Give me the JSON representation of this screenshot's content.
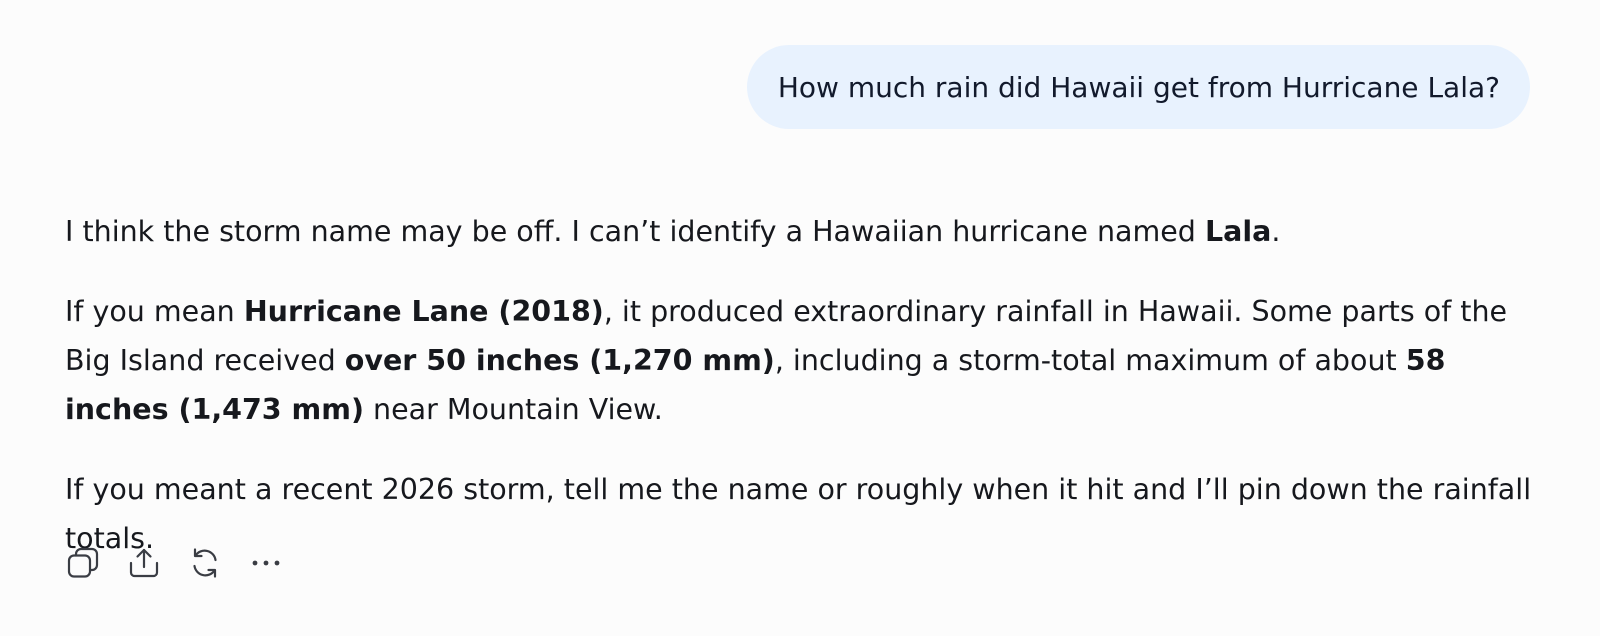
{
  "user_message": {
    "text": "How much rain did Hawaii get from Hurricane Lala?"
  },
  "assistant_message": {
    "p1": {
      "t1": "I think the storm name may be off. I can’t identify a Hawaiian hurricane named ",
      "b1": "Lala",
      "t2": "."
    },
    "p2": {
      "t1": "If you mean ",
      "b1": "Hurricane Lane (2018)",
      "t2": ", it produced extraordinary rainfall in Hawaii. Some parts of the Big Island received ",
      "b2": "over 50 inches (1,270 mm)",
      "t3": ", including a storm-total maximum of about ",
      "b3": "58 inches (1,473 mm)",
      "t4": " near Mountain View."
    },
    "p3": {
      "t1": "If you meant a recent 2026 storm, tell me the name or roughly when it hit and I’ll pin down the rainfall totals."
    }
  },
  "actions": {
    "icons": [
      "copy-icon",
      "share-icon",
      "regenerate-icon",
      "more-icon"
    ]
  },
  "colors": {
    "background": "#fcfcfc",
    "user_bubble": "#e8f2fe",
    "text": "#16181d",
    "icon": "#3a3d44"
  }
}
